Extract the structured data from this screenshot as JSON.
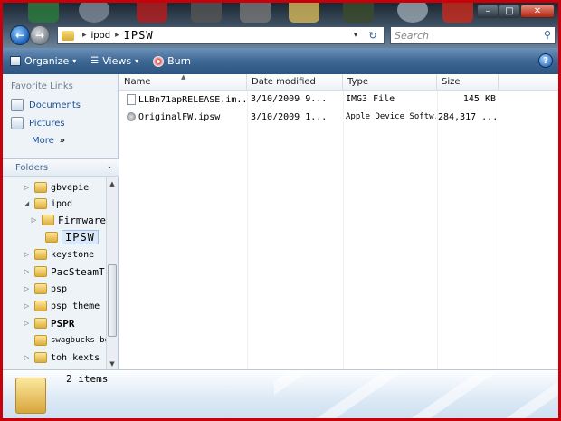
{
  "window": {
    "controls": {
      "minimize": "–",
      "maximize": "□",
      "close": "✕"
    }
  },
  "address": {
    "crumbs": [
      "ipod",
      "IPSW"
    ],
    "search_placeholder": "Search"
  },
  "toolbar": {
    "organize": "Organize",
    "views": "Views",
    "burn": "Burn",
    "help": "?"
  },
  "nav": {
    "favorite_links_title": "Favorite Links",
    "favorites": [
      "Documents",
      "Pictures",
      "More"
    ],
    "folders_title": "Folders",
    "tree": [
      {
        "label": "gbvepie",
        "indent": 1,
        "expanded": false
      },
      {
        "label": "ipod",
        "indent": 1,
        "expanded": true
      },
      {
        "label": "FirmwareBun",
        "indent": 2,
        "expanded": false
      },
      {
        "label": "IPSW",
        "indent": 2,
        "selected": true
      },
      {
        "label": "keystone",
        "indent": 1,
        "expanded": false
      },
      {
        "label": "PacSteamT",
        "indent": 1,
        "expanded": false
      },
      {
        "label": "psp",
        "indent": 1,
        "expanded": false
      },
      {
        "label": "psp theme",
        "indent": 1,
        "expanded": false
      },
      {
        "label": "PSPR",
        "indent": 1,
        "expanded": false
      },
      {
        "label": "swagbucks bot",
        "indent": 1
      },
      {
        "label": "toh kexts",
        "indent": 1,
        "expanded": false
      }
    ]
  },
  "list": {
    "columns": [
      "Name",
      "Date modified",
      "Type",
      "Size"
    ],
    "rows": [
      {
        "name": "LLBn71apRELEASE.im...",
        "date": "3/10/2009 9...",
        "type": "IMG3 File",
        "size": "145 KB",
        "icon": "file-icon"
      },
      {
        "name": "OriginalFW.ipsw",
        "date": "3/10/2009 1...",
        "type": "Apple Device Softw...",
        "size": "284,317 ...",
        "icon": "device-icon"
      }
    ]
  },
  "details": {
    "item_count": "2 items"
  },
  "colors": {
    "frame": "#c8000a",
    "toolbar": "#3e6894",
    "link": "#1a4e94"
  }
}
